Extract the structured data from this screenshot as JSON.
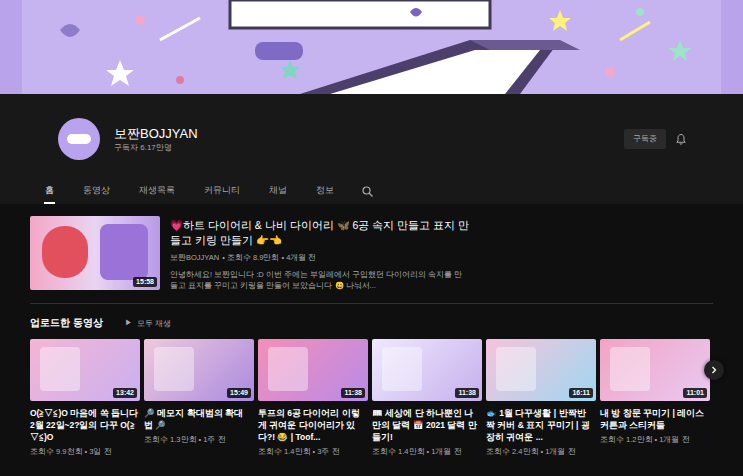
{
  "channel": {
    "name": "보짠BOJJYAN",
    "subscribers": "구독자 6.17만명",
    "subscribe_button": "구독중"
  },
  "tabs": [
    {
      "label": "홈",
      "selected": true
    },
    {
      "label": "동영상",
      "selected": false
    },
    {
      "label": "재생목록",
      "selected": false
    },
    {
      "label": "커뮤니티",
      "selected": false
    },
    {
      "label": "채널",
      "selected": false
    },
    {
      "label": "정보",
      "selected": false
    }
  ],
  "featured": {
    "title": "💗하트 다이어리 & 나비 다이어리 🦋 6공 속지 만들고 표지 만들고 키링 만들기 👉👈",
    "channel": "보짠BOJJYAN",
    "meta": "• 조회수 8.9만회 • 4개월 전",
    "description": "안녕하세요! 보짠입니다 :D 이번 주에는 부일레에서 구입했던 다이어리의 속지를 만들고 표지를 꾸미고 키링을 만들어 보았습니다 😀 나눠서...",
    "duration": "15:58"
  },
  "section": {
    "title": "업로드한 동영상",
    "play_icon": "▶",
    "play_all": "모두 재생"
  },
  "videos": [
    {
      "title": "O(≧▽≦)O 마음에 쏙 듭니다 2월 22일~2?일의 다꾸 O(≧▽≦)O",
      "views": "조회수 9.9천회 • 3일 전",
      "duration": "13:42"
    },
    {
      "title": "🔎 메모지 확대범의 확대법 🔎",
      "views": "조회수 1.3만회 • 1주 전",
      "duration": "15:49"
    },
    {
      "title": "투프의 6공 다이어리 이렇게 귀여운 다이어리가 있다?! 😂 | Toof...",
      "views": "조회수 1.4만회 • 3주 전",
      "duration": "11:38"
    },
    {
      "title": "📖 세상에 단 하나뿐인 나만의 달력 📅 2021 달력 만들기!",
      "views": "조회수 1.4만회 • 1개월 전",
      "duration": "11:38"
    },
    {
      "title": "🐟 1월 다꾸생활 | 반짝반짝 커버 & 표지 꾸미기 | 굉장히 귀여운 ...",
      "views": "조회수 2.4만회 • 1개월 전",
      "duration": "16:11"
    },
    {
      "title": "내 방 창문 꾸미기 | 레이스 커튼과 스티커들",
      "views": "조회수 1.2만회 • 1개월 전",
      "duration": "11:01"
    }
  ]
}
